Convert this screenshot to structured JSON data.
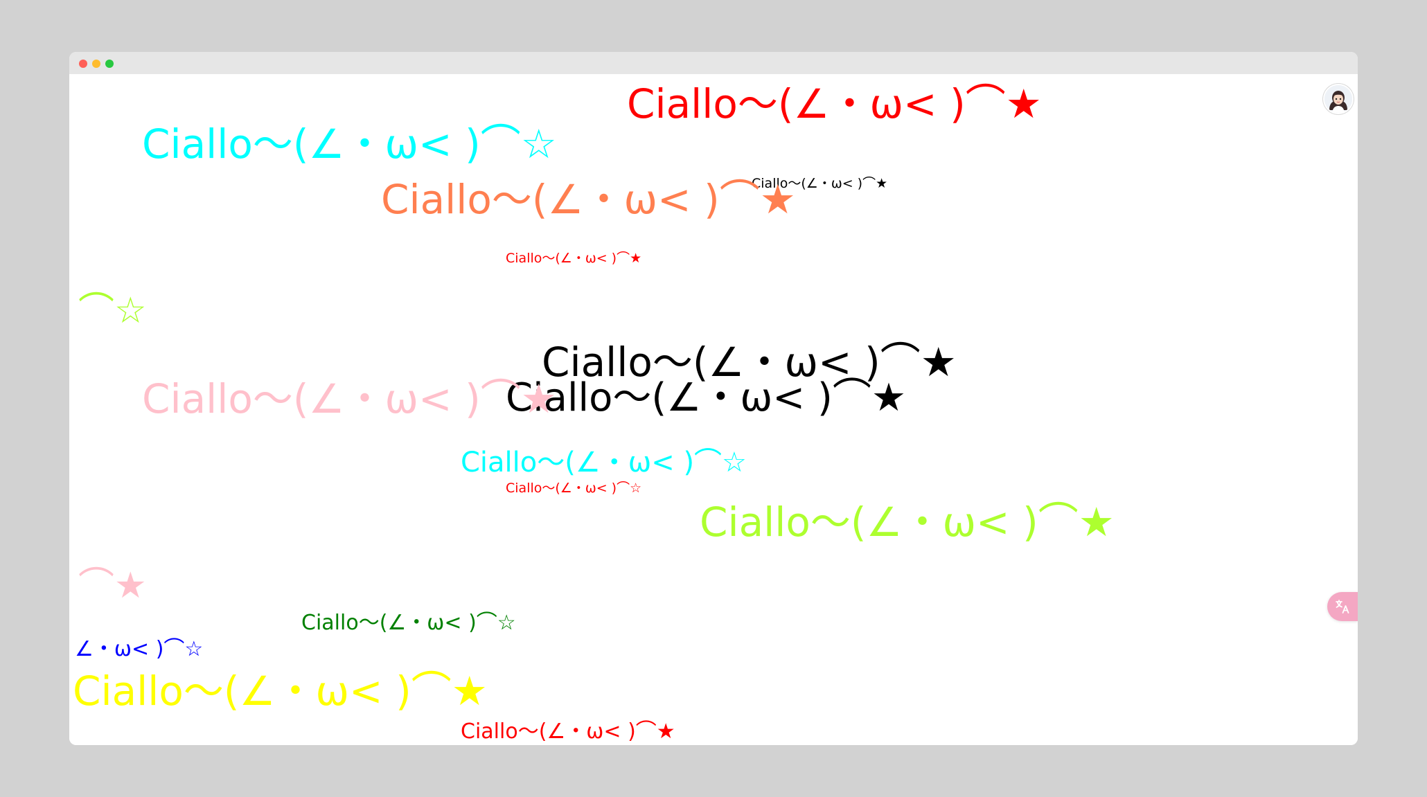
{
  "window": {
    "controls": [
      "close",
      "minimize",
      "maximize"
    ]
  },
  "ciallo_text": "Ciallo～(∠・ω< )⌒★",
  "items": [
    {
      "text": "Ciallo～(∠・ω< )⌒★",
      "color": "#ff0000"
    },
    {
      "text": "Ciallo～(∠・ω< )⌒☆",
      "color": "#00ffff"
    },
    {
      "text": "Ciallo～(∠・ω< )⌒★",
      "color": "#000000"
    },
    {
      "text": "Ciallo～(∠・ω< )⌒★",
      "color": "#ff7f50"
    },
    {
      "text": "Ciallo～(∠・ω< )⌒★",
      "color": "#ff0000"
    },
    {
      "text": "⌒☆",
      "color": "#adff2f"
    },
    {
      "text": "Ciallo～(∠・ω< )⌒★",
      "color": "#000000"
    },
    {
      "text": "Ciallo～(∠・ω< )⌒★",
      "color": "#000000"
    },
    {
      "text": "Ciallo～(∠・ω< )⌒★",
      "color": "#ffc0cb"
    },
    {
      "text": "Ciallo～(∠・ω< )⌒☆",
      "color": "#00ffff"
    },
    {
      "text": "Ciallo～(∠・ω< )⌒☆",
      "color": "#ff0000"
    },
    {
      "text": "Ciallo～(∠・ω< )⌒★",
      "color": "#adff2f"
    },
    {
      "text": "⌒★",
      "color": "#ffc0cb"
    },
    {
      "text": "Ciallo～(∠・ω< )⌒☆",
      "color": "#008000"
    },
    {
      "text": "∠・ω< )⌒☆",
      "color": "#0000ff"
    },
    {
      "text": "Ciallo～(∠・ω< )⌒★",
      "color": "#ffff00"
    },
    {
      "text": "Ciallo～(∠・ω< )⌒★",
      "color": "#ff0000"
    }
  ],
  "icons": {
    "avatar": "user-avatar",
    "translate": "translate-icon"
  }
}
